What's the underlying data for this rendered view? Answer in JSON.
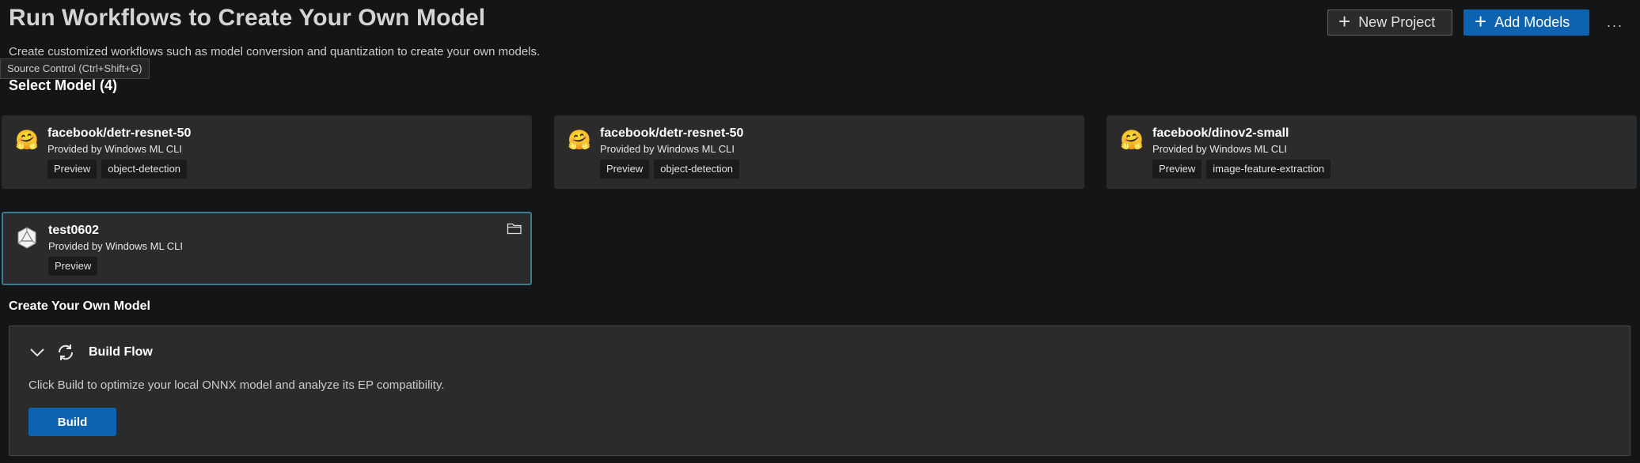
{
  "header": {
    "title": "Run Workflows to Create Your Own Model",
    "subtitle": "Create customized workflows such as model conversion and quantization to create your own models.",
    "new_project_label": "New Project",
    "add_models_label": "Add Models",
    "more_label": "···"
  },
  "tooltip": {
    "text": "Source Control (Ctrl+Shift+G)"
  },
  "select_model": {
    "title": "Select Model (4)"
  },
  "models": [
    {
      "name": "facebook/detr-resnet-50",
      "provider": "Provided by Windows ML CLI",
      "tags": [
        "Preview",
        "object-detection"
      ],
      "icon": "hugging-face-icon"
    },
    {
      "name": "facebook/detr-resnet-50",
      "provider": "Provided by Windows ML CLI",
      "tags": [
        "Preview",
        "object-detection"
      ],
      "icon": "hugging-face-icon"
    },
    {
      "name": "facebook/dinov2-small",
      "provider": "Provided by Windows ML CLI",
      "tags": [
        "Preview",
        "image-feature-extraction"
      ],
      "icon": "hugging-face-icon"
    },
    {
      "name": "test0602",
      "provider": "Provided by Windows ML CLI",
      "tags": [
        "Preview"
      ],
      "icon": "onnx-logo-icon",
      "selected": true
    }
  ],
  "create": {
    "title": "Create Your Own Model",
    "flow_title": "Build Flow",
    "flow_description": "Click Build to optimize your local ONNX model and analyze its EP compatibility.",
    "build_label": "Build"
  },
  "colors": {
    "background": "#141517",
    "card": "#2b2b2b",
    "accent": "#0e63b1",
    "selected_border": "#3b7c93"
  }
}
